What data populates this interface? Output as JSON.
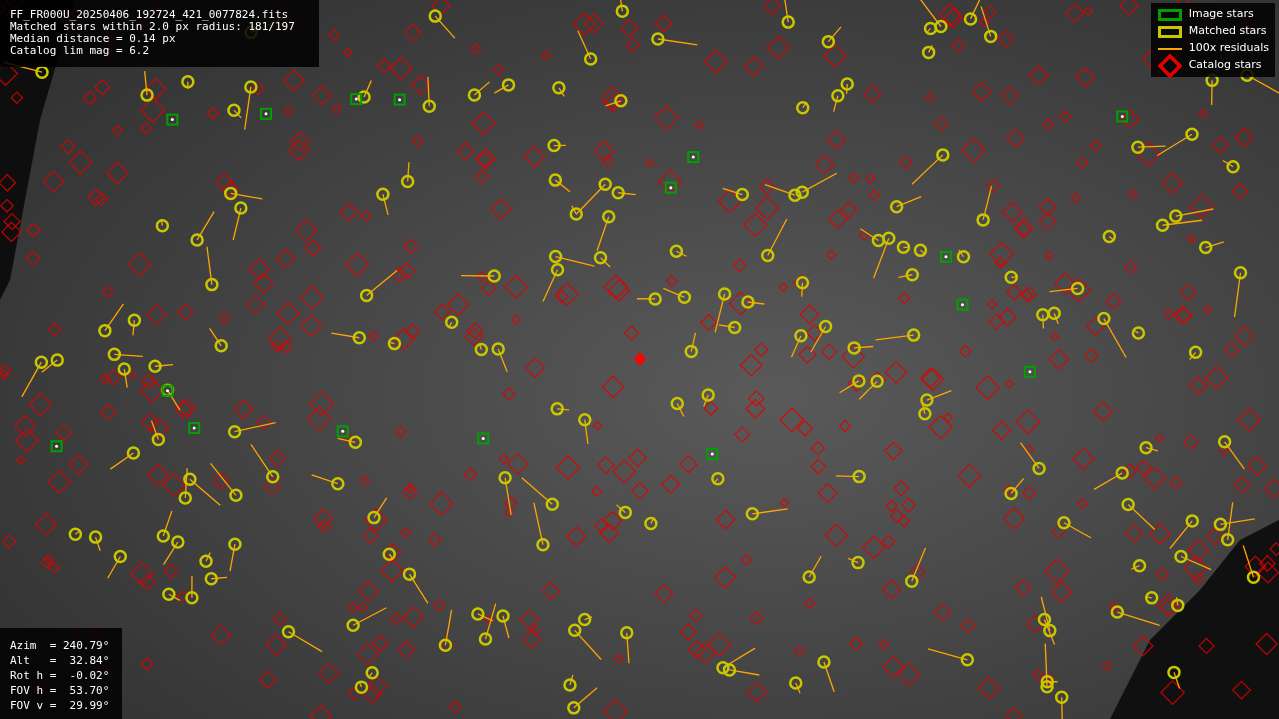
{
  "info_box": {
    "lines": [
      "FF_FR000U_20250406_192724_421_0077824.fits",
      "Matched stars within 2.0 px radius: 181/197",
      "Median distance = 0.14 px",
      "Catalog lim mag = 6.2"
    ]
  },
  "legend": [
    {
      "kind": "image",
      "label": "Image stars",
      "color": "#00a000"
    },
    {
      "kind": "matched",
      "label": "Matched stars",
      "color": "#c8c800"
    },
    {
      "kind": "residual",
      "label": "100x residuals",
      "color": "#ffa500"
    },
    {
      "kind": "catalog",
      "label": "Catalog stars",
      "color": "#e00000"
    }
  ],
  "pointing_box": {
    "lines": [
      "Azim  = 240.79°",
      "Alt   =  32.84°",
      "Rot h =  -0.02°",
      "FOV h =  53.70°",
      "FOV v =  29.99°"
    ]
  }
}
